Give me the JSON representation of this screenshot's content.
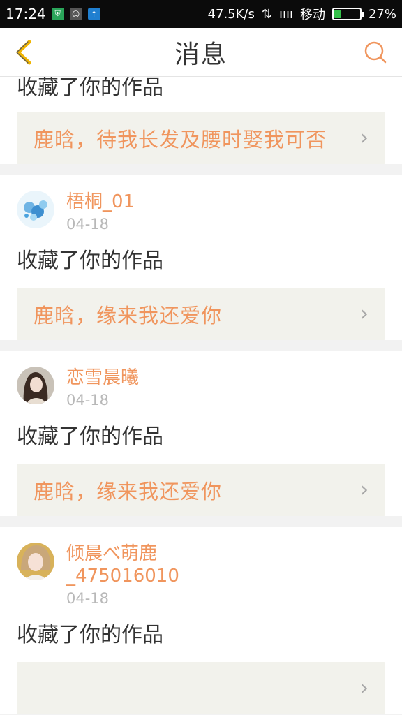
{
  "status_bar": {
    "time": "17:24",
    "speed": "47.5K/s",
    "carrier": "移动",
    "battery": "27%",
    "battery_level": 0.27
  },
  "header": {
    "title": "消息"
  },
  "messages": [
    {
      "action": "收藏了你的作品",
      "work_title": "鹿晗，待我长发及腰时娶我可否"
    },
    {
      "username": "梧桐_01",
      "date": "04-18",
      "action": "收藏了你的作品",
      "work_title": "鹿晗，缘来我还爱你"
    },
    {
      "username": "恋雪晨曦",
      "date": "04-18",
      "action": "收藏了你的作品",
      "work_title": "鹿晗，缘来我还爱你"
    },
    {
      "username": "倾晨べ萌鹿\n_475016010",
      "date": "04-18",
      "action": "收藏了你的作品"
    }
  ],
  "colors": {
    "accent": "#f0955d",
    "back_arrow": "#f0b400",
    "work_bg": "#f2f2ec"
  }
}
